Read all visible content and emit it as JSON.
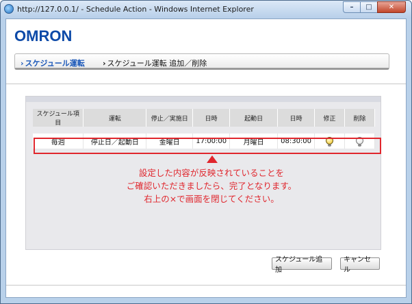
{
  "window": {
    "title": "http://127.0.0.1/ - Schedule Action - Windows Internet Explorer",
    "minimize_glyph": "–",
    "maximize_glyph": "□",
    "close_glyph": "✕"
  },
  "logo": "OMRON",
  "breadcrumb": {
    "items": [
      {
        "label": "スケジュール運転",
        "arrow": "›"
      },
      {
        "label": "スケジュール運転 追加／削除",
        "arrow": "›"
      }
    ]
  },
  "table": {
    "headers": [
      "スケジュール項目",
      "運転",
      "停止／実施日",
      "日時",
      "起動日",
      "日時",
      "修正",
      "削除"
    ],
    "rows": [
      {
        "item": "毎週",
        "operation": "停止日／起動日",
        "stop_day": "金曜日",
        "stop_time": "17:00:00",
        "start_day": "月曜日",
        "start_time": "08:30:00",
        "edit_icon": "lightbulb-on-icon",
        "delete_icon": "lightbulb-off-icon"
      }
    ]
  },
  "callout": {
    "line1": "設定した内容が反映されていることを",
    "line2": "ご確認いただきましたら、完了となります。",
    "line3": "右上の×で画面を閉じてください。",
    "color": "#e0262d"
  },
  "buttons": {
    "add": "スケジュール追加",
    "cancel": "キャンセル"
  }
}
